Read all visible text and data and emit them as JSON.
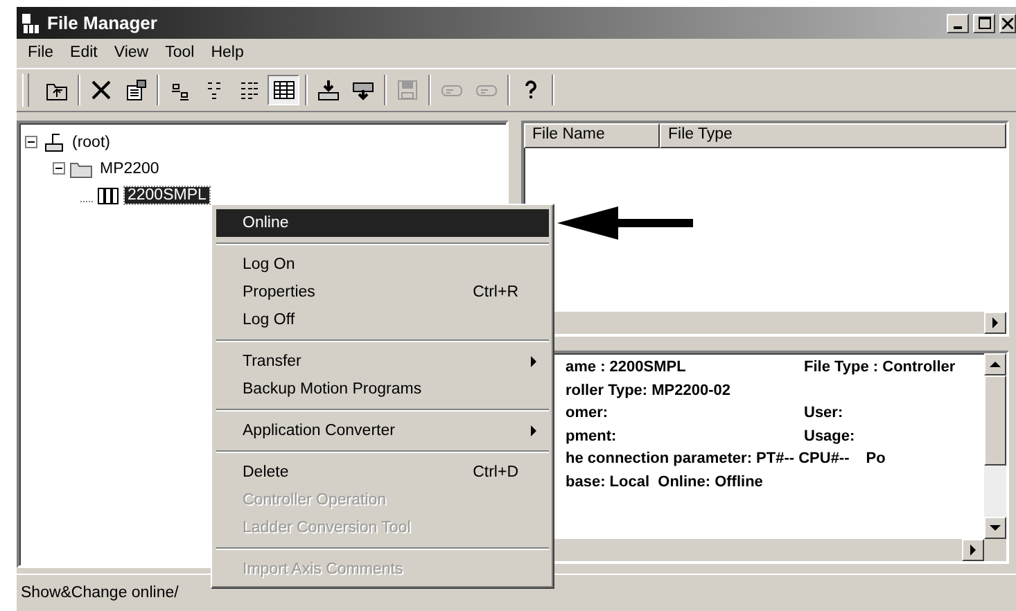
{
  "window": {
    "title": "File Manager"
  },
  "menu_bar": [
    "File",
    "Edit",
    "View",
    "Tool",
    "Help"
  ],
  "toolbar": [
    [
      {
        "disabled": false,
        "selected": false
      }
    ],
    [
      {
        "disabled": false,
        "selected": false
      },
      {
        "disabled": false,
        "selected": false
      }
    ],
    [
      {
        "disabled": false,
        "selected": false
      },
      {
        "disabled": false,
        "selected": false
      },
      {
        "disabled": false,
        "selected": false
      },
      {
        "disabled": false,
        "selected": true
      }
    ],
    [
      {
        "disabled": false,
        "selected": false
      },
      {
        "disabled": false,
        "selected": false
      }
    ],
    [
      {
        "disabled": true,
        "selected": false
      }
    ],
    [
      {
        "disabled": true,
        "selected": false
      },
      {
        "disabled": true,
        "selected": false
      }
    ],
    [
      {
        "disabled": false,
        "selected": false
      }
    ]
  ],
  "tree": [
    {
      "label": "(root)",
      "expanded": true,
      "selected": false,
      "children": [
        {
          "label": "MP2200",
          "expanded": true,
          "selected": false,
          "children": [
            {
              "label": "2200SMPL",
              "selected": true
            }
          ]
        }
      ]
    }
  ],
  "file_list": {
    "columns": [
      "File Name",
      "File Type"
    ]
  },
  "info": {
    "lines": [
      {
        "left": "ame : 2200SMPL",
        "right": "File Type : Controller"
      },
      {
        "left": "roller Type: MP2200-02"
      },
      {
        "left": "omer:",
        "right": "User:"
      },
      {
        "left": "pment:",
        "right": "Usage:"
      },
      {
        "left": "he connection parameter: PT#-- CPU#--",
        "right": "Po"
      },
      {
        "left": "base: Local  Online: Offline"
      }
    ]
  },
  "status_bar": {
    "text": "Show&Change online/"
  },
  "context_menu": [
    {
      "kind": "item",
      "label": "Online",
      "selected": true,
      "disabled": false,
      "submenu": false
    },
    {
      "kind": "separator"
    },
    {
      "kind": "item",
      "label": "Log On",
      "selected": false,
      "disabled": false,
      "submenu": false
    },
    {
      "kind": "item",
      "label": "Properties",
      "shortcut": "Ctrl+R",
      "selected": false,
      "disabled": false,
      "submenu": false
    },
    {
      "kind": "item",
      "label": "Log Off",
      "selected": false,
      "disabled": false,
      "submenu": false
    },
    {
      "kind": "separator"
    },
    {
      "kind": "item",
      "label": "Transfer",
      "selected": false,
      "disabled": false,
      "submenu": true
    },
    {
      "kind": "item",
      "label": "Backup Motion Programs",
      "selected": false,
      "disabled": false,
      "submenu": false
    },
    {
      "kind": "separator"
    },
    {
      "kind": "item",
      "label": "Application Converter",
      "selected": false,
      "disabled": false,
      "submenu": true
    },
    {
      "kind": "separator"
    },
    {
      "kind": "item",
      "label": "Delete",
      "shortcut": "Ctrl+D",
      "selected": false,
      "disabled": false,
      "submenu": false
    },
    {
      "kind": "item",
      "label": "Controller Operation",
      "selected": false,
      "disabled": true,
      "submenu": false
    },
    {
      "kind": "item",
      "label": "Ladder Conversion Tool",
      "selected": false,
      "disabled": true,
      "submenu": false
    },
    {
      "kind": "separator"
    },
    {
      "kind": "item",
      "label": "Import Axis Comments",
      "selected": false,
      "disabled": true,
      "submenu": false
    }
  ]
}
